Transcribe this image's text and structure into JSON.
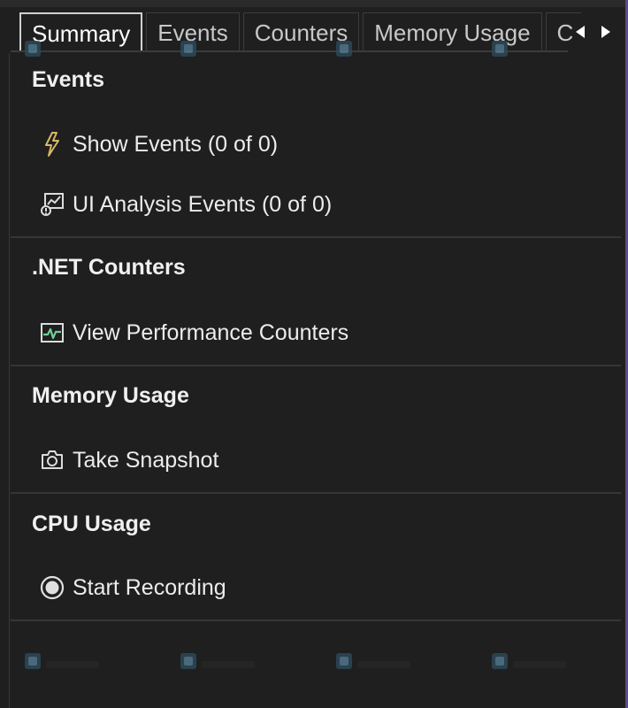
{
  "tabs": [
    {
      "label": "Summary",
      "active": true
    },
    {
      "label": "Events",
      "active": false
    },
    {
      "label": "Counters",
      "active": false
    },
    {
      "label": "Memory Usage",
      "active": false
    },
    {
      "label": "C",
      "active": false
    }
  ],
  "sections": {
    "events": {
      "header": "Events",
      "items": [
        {
          "label": "Show Events (0 of 0)",
          "icon": "lightning-icon"
        },
        {
          "label": "UI Analysis Events (0 of 0)",
          "icon": "ui-analysis-icon"
        }
      ]
    },
    "counters": {
      "header": ".NET Counters",
      "items": [
        {
          "label": "View Performance Counters",
          "icon": "performance-chart-icon"
        }
      ]
    },
    "memory": {
      "header": "Memory Usage",
      "items": [
        {
          "label": "Take Snapshot",
          "icon": "camera-icon"
        }
      ]
    },
    "cpu": {
      "header": "CPU Usage",
      "items": [
        {
          "label": "Start Recording",
          "icon": "record-icon"
        }
      ]
    }
  },
  "colors": {
    "background": "#1f1f1f",
    "text": "#ececec",
    "accent_icon": "#d9b866",
    "counter_icon": "#6fcf97",
    "divider": "#363636",
    "window_border": "#5a4c8c"
  }
}
